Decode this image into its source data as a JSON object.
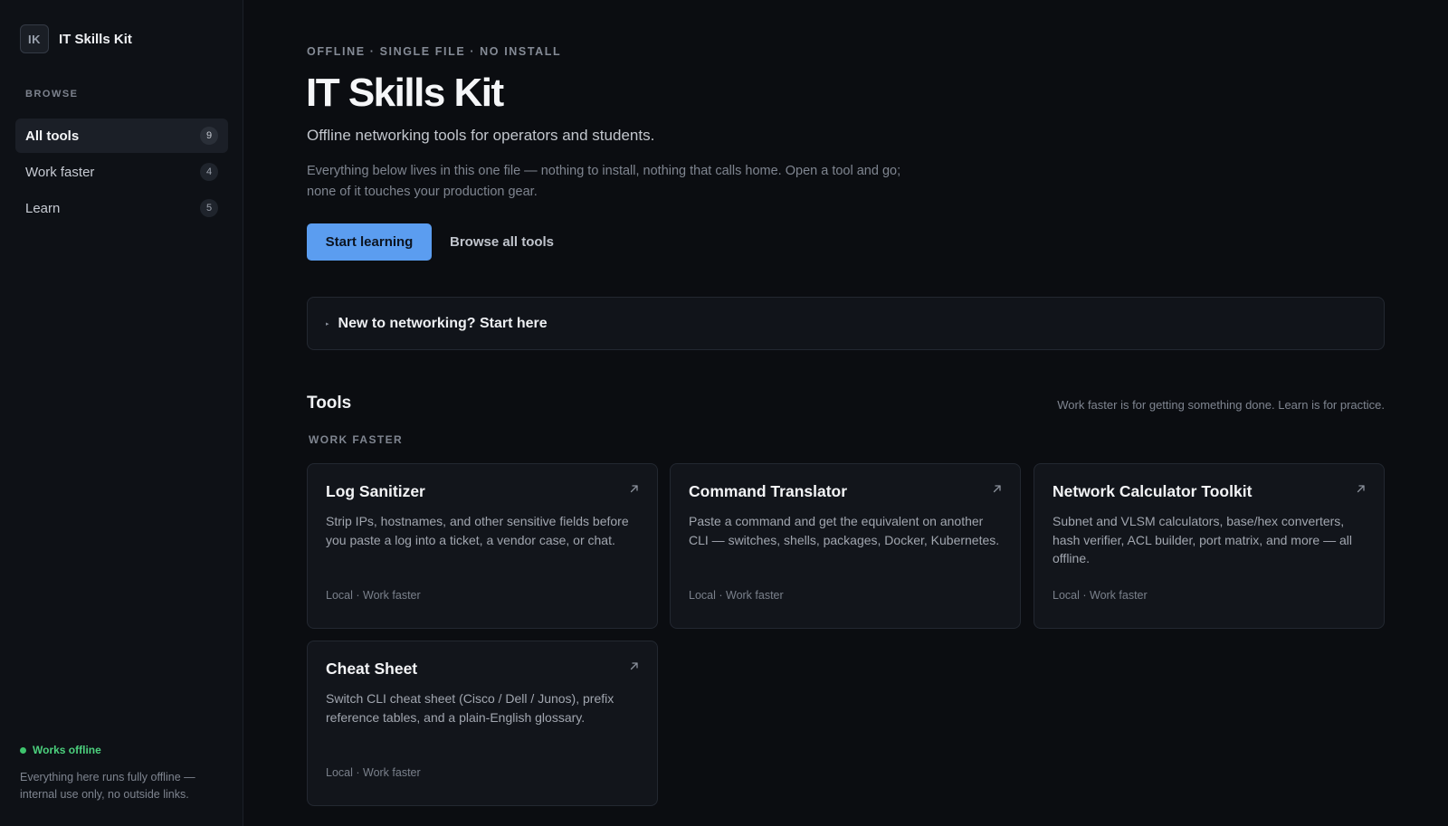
{
  "sidebar": {
    "brand_mark": "IK",
    "brand_name": "IT Skills Kit",
    "browse_label": "BROWSE",
    "items": [
      {
        "label": "All tools",
        "count": "9",
        "active": true
      },
      {
        "label": "Work faster",
        "count": "4",
        "active": false
      },
      {
        "label": "Learn",
        "count": "5",
        "active": false
      }
    ],
    "status": {
      "label": "Works offline",
      "color": "#3ec46d"
    },
    "note": "Everything here runs fully offline — internal use only, no outside links."
  },
  "hero": {
    "eyebrow": "OFFLINE · SINGLE FILE · NO INSTALL",
    "title": "IT Skills Kit",
    "subtitle": "Offline networking tools for operators and students.",
    "description": "Everything below lives in this one file — nothing to install, nothing that calls home. Open a tool and go; none of it touches your production gear.",
    "primary_cta": "Start learning",
    "secondary_cta": "Browse all tools",
    "primary_color": "#5b9df0"
  },
  "intro": {
    "label": "New to networking? Start here",
    "icon": "disclosure-triangle-icon"
  },
  "tools": {
    "heading": "Tools",
    "note": "Work faster is for getting something done. Learn is for practice.",
    "group_label": "WORK FASTER",
    "cards": [
      {
        "title": "Log Sanitizer",
        "description": "Strip IPs, hostnames, and other sensitive fields before you paste a log into a ticket, a vendor case, or chat.",
        "meta": "Local · Work faster",
        "icon": "arrow-up-right-icon"
      },
      {
        "title": "Command Translator",
        "description": "Paste a command and get the equivalent on another CLI — switches, shells, packages, Docker, Kubernetes.",
        "meta": "Local · Work faster",
        "icon": "arrow-up-right-icon"
      },
      {
        "title": "Network Calculator Toolkit",
        "description": "Subnet and VLSM calculators, base/hex converters, hash verifier, ACL builder, port matrix, and more — all offline.",
        "meta": "Local · Work faster",
        "icon": "arrow-up-right-icon"
      },
      {
        "title": "Cheat Sheet",
        "description": "Switch CLI cheat sheet (Cisco / Dell / Junos), prefix reference tables, and a plain-English glossary.",
        "meta": "Local · Work faster",
        "icon": "arrow-up-right-icon"
      }
    ]
  }
}
